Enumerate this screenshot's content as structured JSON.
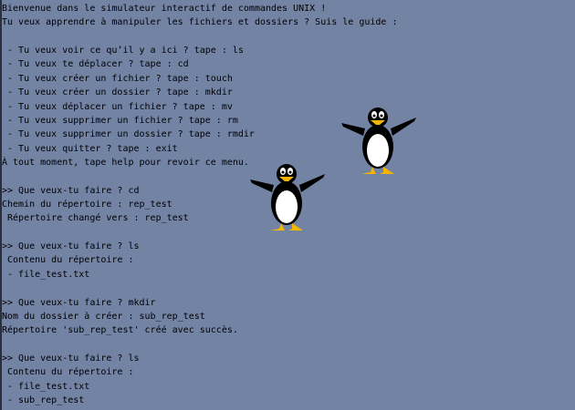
{
  "terminal": {
    "lines": [
      "Bienvenue dans le simulateur interactif de commandes UNIX !",
      "Tu veux apprendre à manipuler les fichiers et dossiers ? Suis le guide :",
      "",
      " - Tu veux voir ce qu’il y a ici ? tape : ls",
      " - Tu veux te déplacer ? tape : cd",
      " - Tu veux créer un fichier ? tape : touch",
      " - Tu veux créer un dossier ? tape : mkdir",
      " - Tu veux déplacer un fichier ? tape : mv",
      " - Tu veux supprimer un fichier ? tape : rm",
      " - Tu veux supprimer un dossier ? tape : rmdir",
      " - Tu veux quitter ? tape : exit",
      "À tout moment, tape help pour revoir ce menu.",
      "",
      ">> Que veux-tu faire ? cd",
      "Chemin du répertoire : rep_test",
      " Répertoire changé vers : rep_test",
      "",
      ">> Que veux-tu faire ? ls",
      " Contenu du répertoire :",
      " - file_test.txt",
      "",
      ">> Que veux-tu faire ? mkdir",
      "Nom du dossier à créer : sub_rep_test",
      "Répertoire 'sub_rep_test' créé avec succès.",
      "",
      ">> Que veux-tu faire ? ls",
      " Contenu du répertoire :",
      " - file_test.txt",
      " - sub_rep_test"
    ]
  },
  "colors": {
    "background": "#7383a3",
    "text": "#000000",
    "beak": "#f5b400"
  }
}
